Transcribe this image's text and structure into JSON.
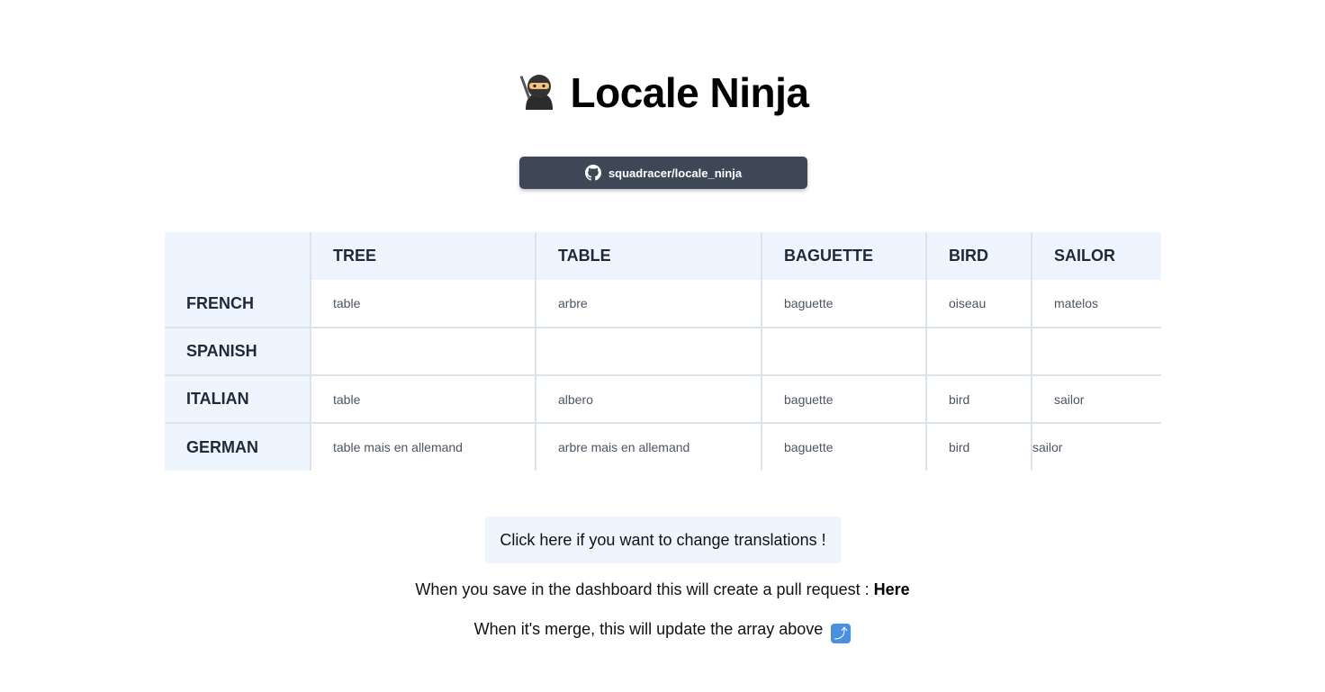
{
  "header": {
    "title": "Locale Ninja",
    "logo_icon": "ninja-icon"
  },
  "repo_button": {
    "label": "squadracer/locale_ninja",
    "icon": "github-icon",
    "color": "#3e4755"
  },
  "table": {
    "columns": [
      "",
      "TREE",
      "TABLE",
      "BAGUETTE",
      "BIRD",
      "SAILOR"
    ],
    "rows": [
      {
        "language": "FRENCH",
        "cells": [
          "table",
          "arbre",
          "baguette",
          "oiseau",
          "matelos"
        ]
      },
      {
        "language": "SPANISH",
        "cells": [
          "",
          "",
          "",
          "",
          ""
        ]
      },
      {
        "language": "ITALIAN",
        "cells": [
          "table",
          "albero",
          "baguette",
          "bird",
          "sailor"
        ]
      },
      {
        "language": "GERMAN",
        "cells": [
          "table mais en allemand",
          "arbre mais en allemand",
          "baguette",
          "bird",
          "sailor"
        ]
      }
    ],
    "header_bg": "#eef5fe"
  },
  "cta": {
    "label": "Click here if you want to change translations !"
  },
  "notes": {
    "pr_text": "When you save in the dashboard this will create a pull request : ",
    "pr_link": "Here",
    "merge_text": "When it's merge, this will update the array above",
    "merge_icon": "arrow-up-icon"
  }
}
